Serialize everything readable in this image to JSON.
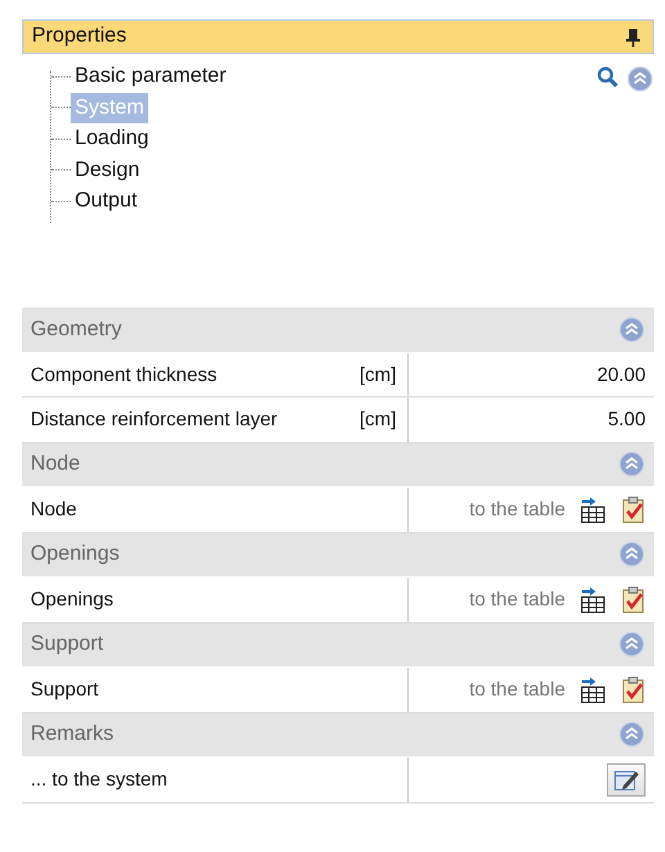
{
  "panel": {
    "title": "Properties"
  },
  "tree": [
    {
      "label": "Basic parameter",
      "selected": false
    },
    {
      "label": "System",
      "selected": true
    },
    {
      "label": "Loading",
      "selected": false
    },
    {
      "label": "Design",
      "selected": false
    },
    {
      "label": "Output",
      "selected": false
    }
  ],
  "sections": [
    {
      "title": "Geometry",
      "expanded": true,
      "rows": [
        {
          "kind": "value",
          "label": "Component thickness",
          "unit": "[cm]",
          "value": "20.00"
        },
        {
          "kind": "value",
          "label": "Distance reinforcement layer",
          "unit": "[cm]",
          "value": "5.00"
        }
      ]
    },
    {
      "title": "Node",
      "expanded": true,
      "rows": [
        {
          "kind": "table",
          "label": "Node",
          "link": "to the table"
        }
      ]
    },
    {
      "title": "Openings",
      "expanded": true,
      "rows": [
        {
          "kind": "table",
          "label": "Openings",
          "link": "to the table"
        }
      ]
    },
    {
      "title": "Support",
      "expanded": true,
      "rows": [
        {
          "kind": "table",
          "label": "Support",
          "link": "to the table"
        }
      ]
    },
    {
      "title": "Remarks",
      "expanded": true,
      "rows": [
        {
          "kind": "remark",
          "label": "... to the system"
        }
      ]
    }
  ]
}
